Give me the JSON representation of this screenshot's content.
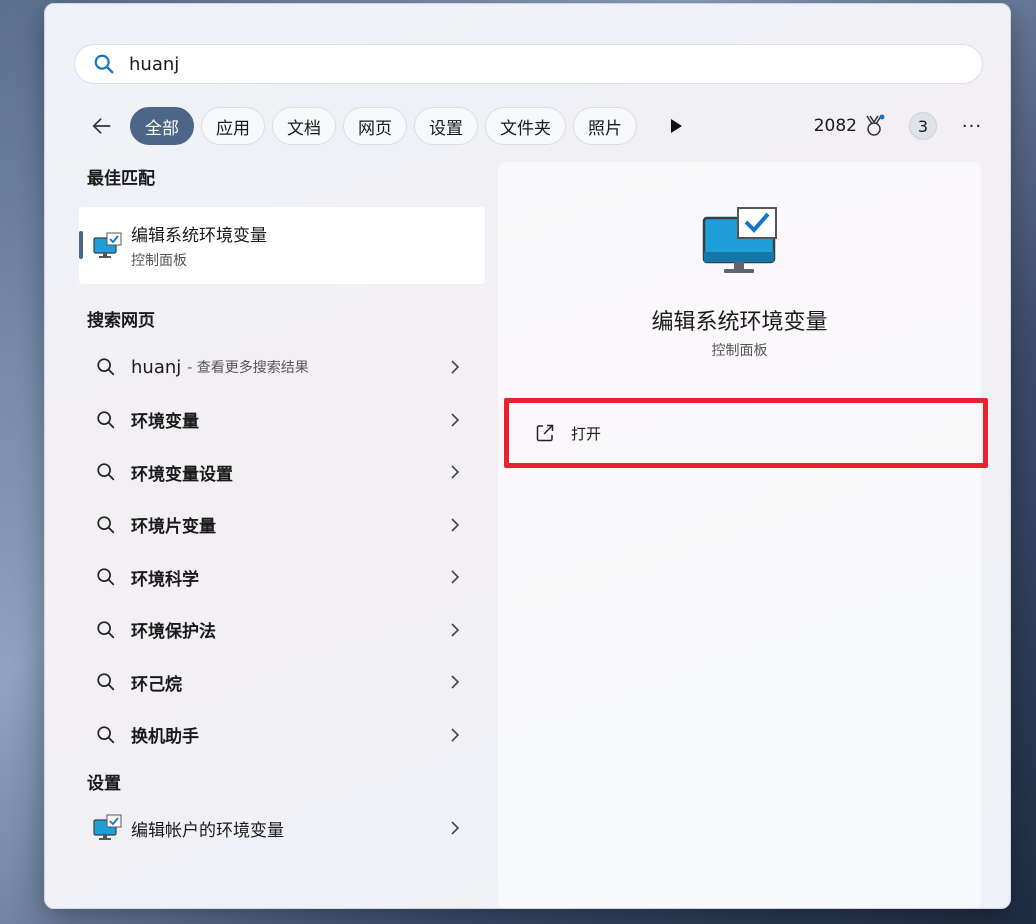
{
  "search": {
    "value": "huanj"
  },
  "filters": [
    "全部",
    "应用",
    "文档",
    "网页",
    "设置",
    "文件夹",
    "照片"
  ],
  "points": "2082",
  "count_badge": "3",
  "more_label": "···",
  "best_match": {
    "section": "最佳匹配",
    "title": "编辑系统环境变量",
    "subtitle": "控制面板"
  },
  "web": {
    "section": "搜索网页",
    "first": {
      "label": "huanj",
      "suffix": "- 查看更多搜索结果"
    },
    "items": [
      "环境变量",
      "环境变量设置",
      "环境片变量",
      "环境科学",
      "环境保护法",
      "环己烷",
      "换机助手"
    ]
  },
  "settings": {
    "section": "设置",
    "item": "编辑帐户的环境变量"
  },
  "preview": {
    "title": "编辑系统环境变量",
    "subtitle": "控制面板",
    "open_label": "打开"
  },
  "colors": {
    "accent": "#4d6586",
    "highlight": "#e8222e"
  }
}
